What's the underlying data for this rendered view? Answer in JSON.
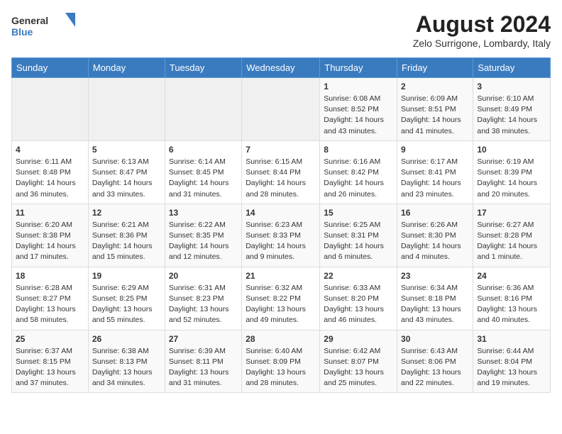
{
  "header": {
    "logo_general": "General",
    "logo_blue": "Blue",
    "month_year": "August 2024",
    "location": "Zelo Surrigone, Lombardy, Italy"
  },
  "days_of_week": [
    "Sunday",
    "Monday",
    "Tuesday",
    "Wednesday",
    "Thursday",
    "Friday",
    "Saturday"
  ],
  "weeks": [
    [
      {
        "day": "",
        "content": ""
      },
      {
        "day": "",
        "content": ""
      },
      {
        "day": "",
        "content": ""
      },
      {
        "day": "",
        "content": ""
      },
      {
        "day": "1",
        "content": "Sunrise: 6:08 AM\nSunset: 8:52 PM\nDaylight: 14 hours and 43 minutes."
      },
      {
        "day": "2",
        "content": "Sunrise: 6:09 AM\nSunset: 8:51 PM\nDaylight: 14 hours and 41 minutes."
      },
      {
        "day": "3",
        "content": "Sunrise: 6:10 AM\nSunset: 8:49 PM\nDaylight: 14 hours and 38 minutes."
      }
    ],
    [
      {
        "day": "4",
        "content": "Sunrise: 6:11 AM\nSunset: 8:48 PM\nDaylight: 14 hours and 36 minutes."
      },
      {
        "day": "5",
        "content": "Sunrise: 6:13 AM\nSunset: 8:47 PM\nDaylight: 14 hours and 33 minutes."
      },
      {
        "day": "6",
        "content": "Sunrise: 6:14 AM\nSunset: 8:45 PM\nDaylight: 14 hours and 31 minutes."
      },
      {
        "day": "7",
        "content": "Sunrise: 6:15 AM\nSunset: 8:44 PM\nDaylight: 14 hours and 28 minutes."
      },
      {
        "day": "8",
        "content": "Sunrise: 6:16 AM\nSunset: 8:42 PM\nDaylight: 14 hours and 26 minutes."
      },
      {
        "day": "9",
        "content": "Sunrise: 6:17 AM\nSunset: 8:41 PM\nDaylight: 14 hours and 23 minutes."
      },
      {
        "day": "10",
        "content": "Sunrise: 6:19 AM\nSunset: 8:39 PM\nDaylight: 14 hours and 20 minutes."
      }
    ],
    [
      {
        "day": "11",
        "content": "Sunrise: 6:20 AM\nSunset: 8:38 PM\nDaylight: 14 hours and 17 minutes."
      },
      {
        "day": "12",
        "content": "Sunrise: 6:21 AM\nSunset: 8:36 PM\nDaylight: 14 hours and 15 minutes."
      },
      {
        "day": "13",
        "content": "Sunrise: 6:22 AM\nSunset: 8:35 PM\nDaylight: 14 hours and 12 minutes."
      },
      {
        "day": "14",
        "content": "Sunrise: 6:23 AM\nSunset: 8:33 PM\nDaylight: 14 hours and 9 minutes."
      },
      {
        "day": "15",
        "content": "Sunrise: 6:25 AM\nSunset: 8:31 PM\nDaylight: 14 hours and 6 minutes."
      },
      {
        "day": "16",
        "content": "Sunrise: 6:26 AM\nSunset: 8:30 PM\nDaylight: 14 hours and 4 minutes."
      },
      {
        "day": "17",
        "content": "Sunrise: 6:27 AM\nSunset: 8:28 PM\nDaylight: 14 hours and 1 minute."
      }
    ],
    [
      {
        "day": "18",
        "content": "Sunrise: 6:28 AM\nSunset: 8:27 PM\nDaylight: 13 hours and 58 minutes."
      },
      {
        "day": "19",
        "content": "Sunrise: 6:29 AM\nSunset: 8:25 PM\nDaylight: 13 hours and 55 minutes."
      },
      {
        "day": "20",
        "content": "Sunrise: 6:31 AM\nSunset: 8:23 PM\nDaylight: 13 hours and 52 minutes."
      },
      {
        "day": "21",
        "content": "Sunrise: 6:32 AM\nSunset: 8:22 PM\nDaylight: 13 hours and 49 minutes."
      },
      {
        "day": "22",
        "content": "Sunrise: 6:33 AM\nSunset: 8:20 PM\nDaylight: 13 hours and 46 minutes."
      },
      {
        "day": "23",
        "content": "Sunrise: 6:34 AM\nSunset: 8:18 PM\nDaylight: 13 hours and 43 minutes."
      },
      {
        "day": "24",
        "content": "Sunrise: 6:36 AM\nSunset: 8:16 PM\nDaylight: 13 hours and 40 minutes."
      }
    ],
    [
      {
        "day": "25",
        "content": "Sunrise: 6:37 AM\nSunset: 8:15 PM\nDaylight: 13 hours and 37 minutes."
      },
      {
        "day": "26",
        "content": "Sunrise: 6:38 AM\nSunset: 8:13 PM\nDaylight: 13 hours and 34 minutes."
      },
      {
        "day": "27",
        "content": "Sunrise: 6:39 AM\nSunset: 8:11 PM\nDaylight: 13 hours and 31 minutes."
      },
      {
        "day": "28",
        "content": "Sunrise: 6:40 AM\nSunset: 8:09 PM\nDaylight: 13 hours and 28 minutes."
      },
      {
        "day": "29",
        "content": "Sunrise: 6:42 AM\nSunset: 8:07 PM\nDaylight: 13 hours and 25 minutes."
      },
      {
        "day": "30",
        "content": "Sunrise: 6:43 AM\nSunset: 8:06 PM\nDaylight: 13 hours and 22 minutes."
      },
      {
        "day": "31",
        "content": "Sunrise: 6:44 AM\nSunset: 8:04 PM\nDaylight: 13 hours and 19 minutes."
      }
    ]
  ]
}
